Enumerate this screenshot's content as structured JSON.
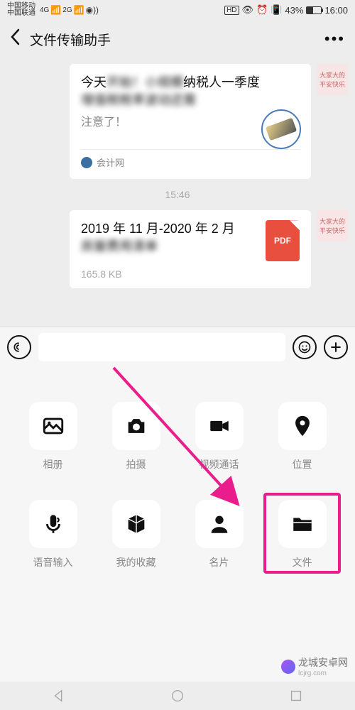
{
  "status_bar": {
    "carrier1": "中国移动",
    "carrier2": "中国联通",
    "net": "4G",
    "net2": "2G",
    "hd": "HD",
    "battery_pct": "43%",
    "time": "16:00"
  },
  "header": {
    "title": "文件传输助手",
    "more": "•••"
  },
  "chat": {
    "msg1": {
      "line1_pre": "今天",
      "line1_blur": "开始！小规模",
      "line1_post": "纳税人一季度",
      "line2_blur": "增值税税率波动还需",
      "sub": "注意了！",
      "source": "会计网"
    },
    "time_label": "15:46",
    "msg2": {
      "fname_line1": "2019 年 11 月-2020 年 2 月",
      "fname_blur": "房屋费用清单",
      "ftype": "PDF",
      "fsize": "165.8 KB"
    }
  },
  "input_bar": {
    "placeholder": ""
  },
  "panel": {
    "items": [
      {
        "key": "album",
        "label": "相册"
      },
      {
        "key": "camera",
        "label": "拍摄"
      },
      {
        "key": "video",
        "label": "视频通话"
      },
      {
        "key": "location",
        "label": "位置"
      },
      {
        "key": "voice",
        "label": "语音输入"
      },
      {
        "key": "fav",
        "label": "我的收藏"
      },
      {
        "key": "contact",
        "label": "名片"
      },
      {
        "key": "file",
        "label": "文件"
      }
    ]
  },
  "watermark": {
    "text": "龙城安卓网",
    "url": "lcjrg.com"
  }
}
